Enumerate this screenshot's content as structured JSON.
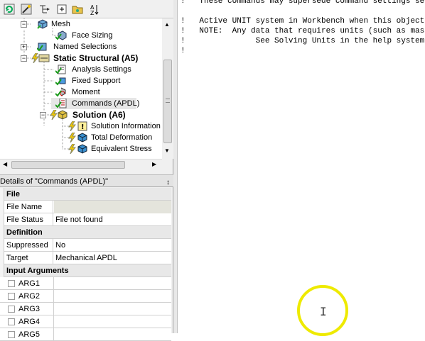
{
  "toolbar": {
    "icons": [
      "refresh-icon",
      "wizard-icon",
      "tree-filter-icon",
      "expand-all-icon",
      "folder-icon",
      "sort-az-icon"
    ]
  },
  "tree": {
    "items": [
      {
        "label": "Mesh",
        "icon": "mesh-icon",
        "bold": false
      },
      {
        "label": "Face Sizing",
        "icon": "face-sizing-icon",
        "bold": false
      },
      {
        "label": "Named Selections",
        "icon": "named-selections-icon",
        "bold": false
      },
      {
        "label": "Static Structural (A5)",
        "icon": "static-structural-icon",
        "bold": true
      },
      {
        "label": "Analysis Settings",
        "icon": "analysis-settings-icon",
        "bold": false
      },
      {
        "label": "Fixed Support",
        "icon": "fixed-support-icon",
        "bold": false
      },
      {
        "label": "Moment",
        "icon": "moment-icon",
        "bold": false
      },
      {
        "label": "Commands (APDL)",
        "icon": "commands-apdl-icon",
        "bold": false
      },
      {
        "label": "Solution (A6)",
        "icon": "solution-icon",
        "bold": true
      },
      {
        "label": "Solution Information",
        "icon": "solution-info-icon",
        "bold": false
      },
      {
        "label": "Total Deformation",
        "icon": "total-deformation-icon",
        "bold": false
      },
      {
        "label": "Equivalent Stress",
        "icon": "equivalent-stress-icon",
        "bold": false
      }
    ]
  },
  "details": {
    "title": "Details of \"Commands (APDL)\"",
    "pin": "↕",
    "sections": {
      "file": "File",
      "definition": "Definition",
      "input_arguments": "Input Arguments"
    },
    "rows": {
      "file_name_label": "File Name",
      "file_name_value": "",
      "file_status_label": "File Status",
      "file_status_value": "File not found",
      "suppressed_label": "Suppressed",
      "suppressed_value": "No",
      "target_label": "Target",
      "target_value": "Mechanical APDL"
    },
    "args": [
      "ARG1",
      "ARG2",
      "ARG3",
      "ARG4",
      "ARG5"
    ]
  },
  "editor": {
    "lines": [
      "!   These commands may supersede command settings set by Workbench.",
      "",
      "!   Active UNIT system in Workbench when this object was created:",
      "!   NOTE:  Any data that requires units (such as mass) is assumed to be in the",
      "!               See Solving Units in the help system for more information.",
      "!"
    ]
  }
}
